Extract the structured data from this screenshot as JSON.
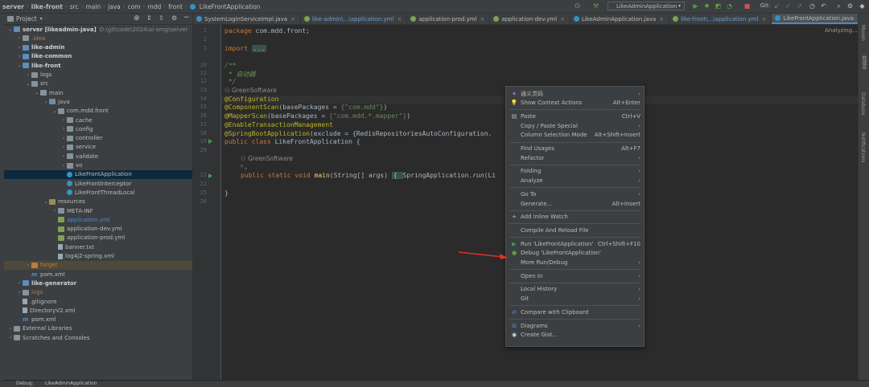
{
  "breadcrumb": [
    "server",
    "like-front",
    "src",
    "main",
    "java",
    "com",
    "mdd",
    "front",
    "LikeFrontApplication"
  ],
  "toolbar": {
    "run_config": "LikeAdminApplication",
    "git_label": "Git:"
  },
  "project_panel": {
    "title": "Project",
    "tree": [
      {
        "label": "server [likeadmin-java]",
        "suffix": "D:\\git\\code\\2024\\ai-xmg\\server",
        "depth": 0,
        "icon": "module-folder",
        "expanded": true,
        "style": "bold"
      },
      {
        "label": ".idea",
        "depth": 1,
        "icon": "folder",
        "expanded": false,
        "style": "orange"
      },
      {
        "label": "like-admin",
        "depth": 1,
        "icon": "module-folder",
        "expanded": false,
        "style": "bold"
      },
      {
        "label": "like-common",
        "depth": 1,
        "icon": "module-folder",
        "expanded": false,
        "style": "bold"
      },
      {
        "label": "like-front",
        "depth": 1,
        "icon": "module-folder",
        "expanded": true,
        "style": "bold"
      },
      {
        "label": "logs",
        "depth": 2,
        "icon": "folder",
        "expanded": false,
        "style": ""
      },
      {
        "label": "src",
        "depth": 2,
        "icon": "folder",
        "expanded": true,
        "style": ""
      },
      {
        "label": "main",
        "depth": 3,
        "icon": "folder",
        "expanded": true,
        "style": ""
      },
      {
        "label": "java",
        "depth": 4,
        "icon": "src-folder",
        "expanded": true,
        "style": ""
      },
      {
        "label": "com.mdd.front",
        "depth": 5,
        "icon": "folder",
        "expanded": true,
        "style": ""
      },
      {
        "label": "cache",
        "depth": 6,
        "icon": "folder",
        "expanded": false,
        "style": ""
      },
      {
        "label": "config",
        "depth": 6,
        "icon": "folder",
        "expanded": false,
        "style": ""
      },
      {
        "label": "controller",
        "depth": 6,
        "icon": "folder",
        "expanded": false,
        "style": ""
      },
      {
        "label": "service",
        "depth": 6,
        "icon": "folder",
        "expanded": false,
        "style": ""
      },
      {
        "label": "validate",
        "depth": 6,
        "icon": "folder",
        "expanded": false,
        "style": ""
      },
      {
        "label": "vo",
        "depth": 6,
        "icon": "folder",
        "expanded": false,
        "style": ""
      },
      {
        "label": "LikeFrontApplication",
        "depth": 6,
        "icon": "class",
        "leaf": true,
        "style": "",
        "selected": true
      },
      {
        "label": "LikeFrontInterceptor",
        "depth": 6,
        "icon": "class",
        "leaf": true,
        "style": ""
      },
      {
        "label": "LikeFrontThreadLocal",
        "depth": 6,
        "icon": "class",
        "leaf": true,
        "style": ""
      },
      {
        "label": "resources",
        "depth": 4,
        "icon": "res-folder",
        "expanded": true,
        "style": ""
      },
      {
        "label": "META-INF",
        "depth": 5,
        "icon": "folder",
        "expanded": false,
        "style": ""
      },
      {
        "label": "application.yml",
        "depth": 5,
        "icon": "yml",
        "leaf": true,
        "style": "blue"
      },
      {
        "label": "application-dev.yml",
        "depth": 5,
        "icon": "yml",
        "leaf": true,
        "style": ""
      },
      {
        "label": "application-prod.yml",
        "depth": 5,
        "icon": "yml",
        "leaf": true,
        "style": ""
      },
      {
        "label": "banner.txt",
        "depth": 5,
        "icon": "txt",
        "leaf": true,
        "style": ""
      },
      {
        "label": "log4j2-spring.xml",
        "depth": 5,
        "icon": "txt",
        "leaf": true,
        "style": ""
      },
      {
        "label": "target",
        "depth": 2,
        "icon": "excluded-folder",
        "expanded": false,
        "style": "orange",
        "highlight": true
      },
      {
        "label": "pom.xml",
        "depth": 2,
        "icon": "maven",
        "leaf": true,
        "style": ""
      },
      {
        "label": "like-generator",
        "depth": 1,
        "icon": "module-folder",
        "expanded": false,
        "style": "bold"
      },
      {
        "label": "logs",
        "depth": 1,
        "icon": "folder",
        "expanded": false,
        "style": "orange"
      },
      {
        "label": ".gitignore",
        "depth": 1,
        "icon": "txt",
        "leaf": true,
        "style": ""
      },
      {
        "label": "DirectoryV2.xml",
        "depth": 1,
        "icon": "txt",
        "leaf": true,
        "style": ""
      },
      {
        "label": "pom.xml",
        "depth": 1,
        "icon": "maven",
        "leaf": true,
        "style": ""
      },
      {
        "label": "External Libraries",
        "depth": 0,
        "icon": "folder",
        "expanded": false,
        "style": ""
      },
      {
        "label": "Scratches and Consoles",
        "depth": 0,
        "icon": "folder",
        "expanded": false,
        "style": ""
      }
    ]
  },
  "tabs": [
    {
      "label": "SystemLoginServiceImpl.java",
      "color": "#3592c4",
      "style": ""
    },
    {
      "label": "like-admin\\...\\application.yml",
      "color": "#7ea253",
      "style": "mod-blue"
    },
    {
      "label": "application-prod.yml",
      "color": "#7ea253",
      "style": ""
    },
    {
      "label": "application-dev.yml",
      "color": "#7ea253",
      "style": ""
    },
    {
      "label": "LikeAdminApplication.java",
      "color": "#3592c4",
      "style": ""
    },
    {
      "label": "like-front\\...\\application.yml",
      "color": "#7ea253",
      "style": "mod-blue"
    },
    {
      "label": "LikeFrontApplication.java",
      "color": "#3592c4",
      "style": "active"
    }
  ],
  "editor": {
    "status": "Analyzing...",
    "line_numbers": [
      "1",
      "2",
      "3",
      "10",
      "11",
      "12",
      "13",
      "",
      "14",
      "15",
      "16",
      "17",
      "18",
      "19",
      "20",
      "",
      "21",
      "22",
      "25",
      "26"
    ],
    "line1_kw": "package",
    "line1_rest": " com.mdd.front;",
    "import_kw": "import",
    "import_fold": "...",
    "doc_open": "/**",
    "doc_text": " * 启动器",
    "doc_close": " */",
    "author_hint_1": "GreenSoftware",
    "ann_configuration": "@Configuration",
    "ann_component_scan": "@ComponentScan",
    "component_scan_args_a": "(basePackages = ",
    "component_scan_str": "{\"com.mdd\"}",
    "component_scan_args_b": ")",
    "ann_mapper_scan": "@MapperScan",
    "mapper_scan_args_a": "(basePackages = ",
    "mapper_scan_str": "{\"com.mdd.*.mapper\"}",
    "mapper_scan_args_b": ")",
    "ann_enable_tx": "@EnableTransactionManagement",
    "ann_spring_boot": "@SpringBootApplication",
    "spring_boot_args": "(exclude = {RedisRepositoriesAutoConfiguration.",
    "class_kw": "public class",
    "class_name": " LikeFrontApplication {",
    "author_hint_2": "GreenSoftware",
    "hint_glyph": "ᴿ⌄",
    "main_kw": "public static void",
    "main_name": " main",
    "main_args": "(String[] args) ",
    "main_body_open": "{ ",
    "main_call": "SpringApplication.",
    "main_run": "run",
    "main_tail": "(Li",
    "close_brace": "}"
  },
  "context_menu": {
    "items": [
      {
        "label": "通义灵码",
        "shortcut": "",
        "submenu": true,
        "icon": "tongyi-icon"
      },
      {
        "label": "Show Context Actions",
        "shortcut": "Alt+Enter",
        "submenu": false,
        "icon": "bulb-icon"
      },
      {
        "sep": true
      },
      {
        "label": "Paste",
        "shortcut": "Ctrl+V",
        "submenu": false,
        "icon": "paste-icon"
      },
      {
        "label": "Copy / Paste Special",
        "shortcut": "",
        "submenu": true,
        "icon": ""
      },
      {
        "label": "Column Selection Mode",
        "shortcut": "Alt+Shift+Insert",
        "submenu": false,
        "icon": ""
      },
      {
        "sep": true
      },
      {
        "label": "Find Usages",
        "shortcut": "Alt+F7",
        "submenu": false,
        "icon": ""
      },
      {
        "label": "Refactor",
        "shortcut": "",
        "submenu": true,
        "icon": ""
      },
      {
        "sep": true
      },
      {
        "label": "Folding",
        "shortcut": "",
        "submenu": true,
        "icon": ""
      },
      {
        "label": "Analyze",
        "shortcut": "",
        "submenu": true,
        "icon": ""
      },
      {
        "sep": true
      },
      {
        "label": "Go To",
        "shortcut": "",
        "submenu": true,
        "icon": ""
      },
      {
        "label": "Generate...",
        "shortcut": "Alt+Insert",
        "submenu": false,
        "icon": ""
      },
      {
        "sep": true
      },
      {
        "label": "Add Inline Watch",
        "shortcut": "",
        "submenu": false,
        "icon": "watch-icon"
      },
      {
        "sep": true
      },
      {
        "label": "Compile And Reload File",
        "shortcut": "",
        "submenu": false,
        "icon": ""
      },
      {
        "sep": true
      },
      {
        "label": "Run 'LikeFrontApplication'",
        "shortcut": "Ctrl+Shift+F10",
        "submenu": false,
        "icon": "run-icon"
      },
      {
        "label": "Debug 'LikeFrontApplication'",
        "shortcut": "",
        "submenu": false,
        "icon": "debug-icon"
      },
      {
        "label": "More Run/Debug",
        "shortcut": "",
        "submenu": true,
        "icon": ""
      },
      {
        "sep": true
      },
      {
        "label": "Open In",
        "shortcut": "",
        "submenu": true,
        "icon": ""
      },
      {
        "sep": true
      },
      {
        "label": "Local History",
        "shortcut": "",
        "submenu": true,
        "icon": ""
      },
      {
        "label": "Git",
        "shortcut": "",
        "submenu": true,
        "icon": ""
      },
      {
        "sep": true
      },
      {
        "label": "Compare with Clipboard",
        "shortcut": "",
        "submenu": false,
        "icon": "compare-icon"
      },
      {
        "sep": true
      },
      {
        "label": "Diagrams",
        "shortcut": "",
        "submenu": true,
        "icon": "diagram-icon"
      },
      {
        "label": "Create Gist...",
        "shortcut": "",
        "submenu": false,
        "icon": "github-icon"
      }
    ]
  },
  "right_stripe": [
    "Maven",
    "数据库",
    "Database",
    "Notifications"
  ],
  "bottom_bar": {
    "label": "Debug:",
    "config": "LikeAdminApplication"
  },
  "colors": {
    "accent": "#4a88c7",
    "run_green": "#499c54",
    "debug_green": "#5f9f47",
    "arrow_red": "#e0302a"
  }
}
